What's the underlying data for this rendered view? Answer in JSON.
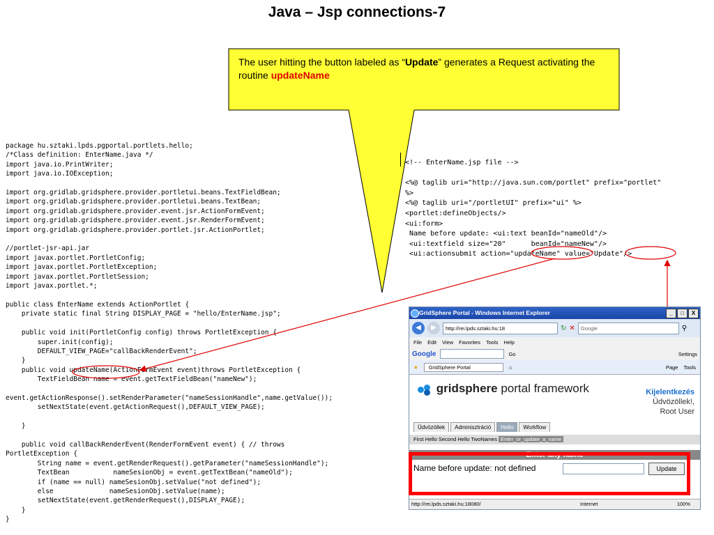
{
  "slide": {
    "title": "Java – Jsp connections-7",
    "callout": {
      "text_before": "The user hitting the button labeled as “",
      "bold": "Update",
      "text_middle": "” generates a Request activating the routine ",
      "red": "updateName"
    }
  },
  "java_code": "package hu.sztaki.lpds.pgportal.portlets.hello;\n/*Class definition: EnterName.java */\nimport java.io.PrintWriter;\nimport java.io.IOException;\n\nimport org.gridlab.gridsphere.provider.portletui.beans.TextFieldBean;\nimport org.gridlab.gridsphere.provider.portletui.beans.TextBean;\nimport org.gridlab.gridsphere.provider.event.jsr.ActionFormEvent;\nimport org.gridlab.gridsphere.provider.event.jsr.RenderFormEvent;\nimport org.gridlab.gridsphere.provider.portlet.jsr.ActionPortlet;\n\n//portlet-jsr-api.jar\nimport javax.portlet.PortletConfig;\nimport javax.portlet.PortletException;\nimport javax.portlet.PortletSession;\nimport javax.portlet.*;\n\npublic class EnterName extends ActionPortlet {\n    private static final String DISPLAY_PAGE = \"hello/EnterName.jsp\";\n\n    public void init(PortletConfig config) throws PortletException {\n        super.init(config);\n        DEFAULT_VIEW_PAGE=\"callBackRenderEvent\";\n    }\n    public void updateName(ActionFormEvent event)throws PortletException {\n        TextFieldBean name = event.getTextFieldBean(\"nameNew\");\n\nevent.getActionResponse().setRenderParameter(\"nameSessionHandle\",name.getValue());\n        setNextState(event.getActionRequest(),DEFAULT_VIEW_PAGE);\n\n    }\n\n    public void callBackRenderEvent(RenderFormEvent event) { // throws\nPortletException {\n        String name = event.getRenderRequest().getParameter(\"nameSessionHandle\");\n        TextBean           nameSesionObj = event.getTextBean(\"nameOld\");\n        if (name == null) nameSesionObj.setValue(\"not defined\");\n        else              nameSesionObj.setValue(name);\n        setNextState(event.getRenderRequest(),DISPLAY_PAGE);\n    }\n}",
  "jsp_code": "<!-- EnterName.jsp file -->\n\n<%@ taglib uri=\"http://java.sun.com/portlet\" prefix=\"portlet\"\n%>\n<%@ taglib uri=\"/portletUI\" prefix=\"ui\" %>\n<portlet:defineObjects/>\n<ui:form>\n Name before update: <ui:text beanId=\"nameOld\"/>\n <ui:textfield size=\"20\"      beanId=\"nameNew\"/>\n <ui:actionsubmit action=\"updateName\" value=\"Update\"/>",
  "browser": {
    "window_title": "GridSphere Portal - Windows Internet Explorer",
    "window_buttons": [
      "_",
      "□",
      "X"
    ],
    "address": "http://rei.lpds.sztaki.hu:18",
    "search_placeholder": "Google",
    "menu": [
      "File",
      "Edit",
      "View",
      "Favorites",
      "Tools",
      "Help"
    ],
    "google_label": "Google",
    "google_go": "Go",
    "settings_label": "Settings",
    "tab_label": "GridSphere Portal",
    "page_label": "Page",
    "tools_label": "Tools",
    "logo_bold": "gridsphere",
    "logo_rest": " portal framework",
    "login_link": "Kijelentkezés",
    "welcome": "Üdvözöllek!,",
    "user": "Root User",
    "portal_tabs": [
      "Üdvözöllek",
      "Adminisztráció",
      "Hello",
      "Workflow"
    ],
    "subnav_items": [
      "First Hello",
      "Second Hello",
      "TwoNames"
    ],
    "subnav_current": "Enter_or_update_a_name",
    "portlet_title": "Enter any name",
    "form_label": "Name before update: not defined",
    "update_button": "Update",
    "status_url": "http://rei.lpds.sztaki.hu:18080/",
    "status_zone": "Internet",
    "status_zoom": "100%"
  }
}
